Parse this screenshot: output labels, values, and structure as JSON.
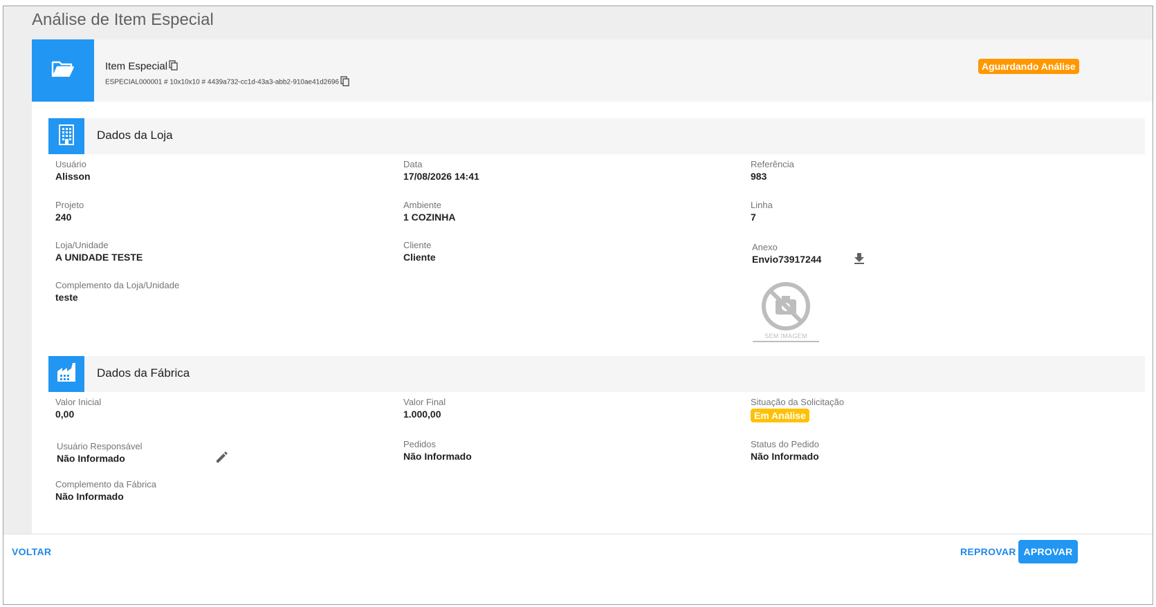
{
  "page": {
    "title": "Análise de Item Especial"
  },
  "item": {
    "title": "Item Especial",
    "subtitle": "ESPECIAL000001 # 10x10x10 # 4439a732-cc1d-43a3-abb2-910ae41d2696",
    "status": "Aguardando Análise",
    "status_color": "#ff9800",
    "icon": "folder-open-icon"
  },
  "store_section": {
    "title": "Dados da Loja",
    "icon": "building-icon",
    "fields": {
      "usuario": {
        "label": "Usuário",
        "value": "Alisson"
      },
      "data": {
        "label": "Data",
        "value": "17/08/2026 14:41"
      },
      "referencia": {
        "label": "Referência",
        "value": "983"
      },
      "projeto": {
        "label": "Projeto",
        "value": "240"
      },
      "ambiente": {
        "label": "Ambiente",
        "value": "1 COZINHA"
      },
      "linha": {
        "label": "Linha",
        "value": "7"
      },
      "loja": {
        "label": "Loja/Unidade",
        "value": "A UNIDADE TESTE"
      },
      "cliente": {
        "label": "Cliente",
        "value": "Cliente"
      },
      "anexo": {
        "label": "Anexo",
        "value": "Envio73917244"
      },
      "complemento": {
        "label": "Complemento da Loja/Unidade",
        "value": "teste"
      }
    },
    "no_image_caption": "SEM IMAGEM"
  },
  "factory_section": {
    "title": "Dados da Fábrica",
    "icon": "factory-icon",
    "fields": {
      "valor_inicial": {
        "label": "Valor Inicial",
        "value": "0,00"
      },
      "valor_final": {
        "label": "Valor Final",
        "value": "1.000,00"
      },
      "situacao": {
        "label": "Situação da Solicitação",
        "value": "Em Análise"
      },
      "usuario_responsavel": {
        "label": "Usuário Responsável",
        "value": "Não Informado"
      },
      "pedidos": {
        "label": "Pedidos",
        "value": "Não Informado"
      },
      "status_pedido": {
        "label": "Status do Pedido",
        "value": "Não Informado"
      },
      "complemento": {
        "label": "Complemento da Fábrica",
        "value": "Não Informado"
      }
    },
    "situacao_color": "#ffc107"
  },
  "footer": {
    "back_label": "VOLTAR",
    "reject_label": "REPROVAR",
    "approve_label": "APROVAR"
  },
  "colors": {
    "primary": "#2196f3",
    "link": "#1e88e5"
  }
}
